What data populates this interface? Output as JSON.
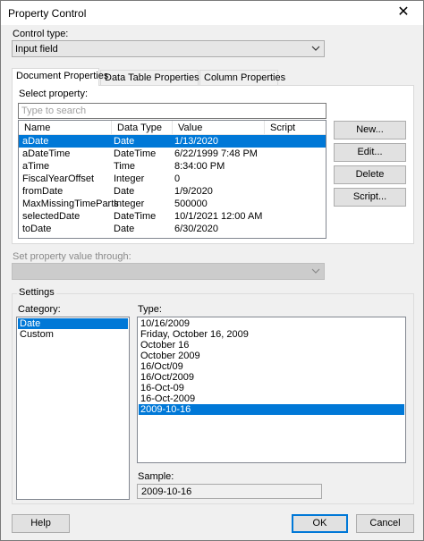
{
  "window": {
    "title": "Property Control",
    "close_glyph": "✕"
  },
  "control_type": {
    "label": "Control type:",
    "value": "Input field"
  },
  "tabs": [
    {
      "label": "Document Properties",
      "active": true
    },
    {
      "label": "Data Table Properties",
      "active": false
    },
    {
      "label": "Column Properties",
      "active": false
    }
  ],
  "select_property": {
    "label": "Select property:",
    "search_placeholder": "Type to search"
  },
  "columns": [
    "Name",
    "Data Type",
    "Value",
    "Script"
  ],
  "rows": [
    {
      "name": "aDate",
      "type": "Date",
      "value": "1/13/2020",
      "script": "",
      "selected": true
    },
    {
      "name": "aDateTime",
      "type": "DateTime",
      "value": "6/22/1999 7:48 PM",
      "script": ""
    },
    {
      "name": "aTime",
      "type": "Time",
      "value": "8:34:00 PM",
      "script": ""
    },
    {
      "name": "FiscalYearOffset",
      "type": "Integer",
      "value": "0",
      "script": ""
    },
    {
      "name": "fromDate",
      "type": "Date",
      "value": "1/9/2020",
      "script": ""
    },
    {
      "name": "MaxMissingTimeParts",
      "type": "Integer",
      "value": "500000",
      "script": ""
    },
    {
      "name": "selectedDate",
      "type": "DateTime",
      "value": "10/1/2021 12:00 AM",
      "script": ""
    },
    {
      "name": "toDate",
      "type": "Date",
      "value": "6/30/2020",
      "script": ""
    }
  ],
  "side_buttons": {
    "new": "New...",
    "edit": "Edit...",
    "delete": "Delete",
    "script": "Script..."
  },
  "set_value_through": {
    "label": "Set property value through:",
    "value": ""
  },
  "settings": {
    "legend": "Settings",
    "category_label": "Category:",
    "categories": [
      {
        "label": "Date",
        "selected": true
      },
      {
        "label": "Custom",
        "selected": false
      }
    ],
    "type_label": "Type:",
    "types": [
      {
        "label": "10/16/2009",
        "selected": false
      },
      {
        "label": "Friday, October 16, 2009",
        "selected": false
      },
      {
        "label": "October 16",
        "selected": false
      },
      {
        "label": "October 2009",
        "selected": false
      },
      {
        "label": "16/Oct/09",
        "selected": false
      },
      {
        "label": "16/Oct/2009",
        "selected": false
      },
      {
        "label": "16-Oct-09",
        "selected": false
      },
      {
        "label": "16-Oct-2009",
        "selected": false
      },
      {
        "label": "2009-10-16",
        "selected": true
      }
    ],
    "sample_label": "Sample:",
    "sample_value": "2009-10-16"
  },
  "footer": {
    "help": "Help",
    "ok": "OK",
    "cancel": "Cancel"
  },
  "colors": {
    "selection": "#0078d7",
    "default_button_border": "#0078d7"
  }
}
